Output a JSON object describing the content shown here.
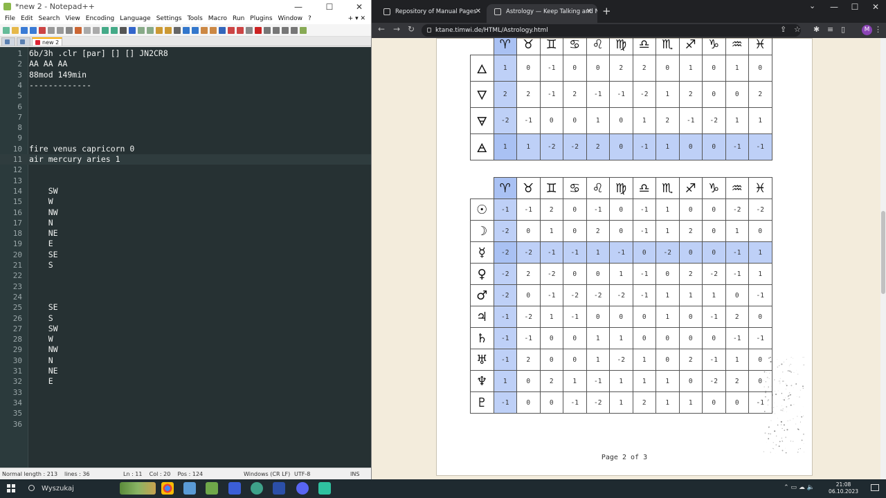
{
  "notepad": {
    "title": "*new 2 - Notepad++",
    "menu": [
      "File",
      "Edit",
      "Search",
      "View",
      "Encoding",
      "Language",
      "Settings",
      "Tools",
      "Macro",
      "Run",
      "Plugins",
      "Window",
      "?"
    ],
    "tabs": [
      {
        "label": ""
      },
      {
        "label": ""
      },
      {
        "label": "new 2"
      }
    ],
    "lines": [
      {
        "n": "1",
        "t": "6b/3h .clr [par] [] [] JN2CR8"
      },
      {
        "n": "2",
        "t": "AA AA AA"
      },
      {
        "n": "3",
        "t": "88mod 149min"
      },
      {
        "n": "4",
        "t": "-------------"
      },
      {
        "n": "5",
        "t": ""
      },
      {
        "n": "6",
        "t": ""
      },
      {
        "n": "7",
        "t": ""
      },
      {
        "n": "8",
        "t": ""
      },
      {
        "n": "9",
        "t": ""
      },
      {
        "n": "10",
        "t": "fire venus capricorn 0"
      },
      {
        "n": "11",
        "t": "air mercury aries 1"
      },
      {
        "n": "12",
        "t": ""
      },
      {
        "n": "13",
        "t": ""
      },
      {
        "n": "14",
        "t": "    SW"
      },
      {
        "n": "15",
        "t": "    W"
      },
      {
        "n": "16",
        "t": "    NW"
      },
      {
        "n": "17",
        "t": "    N"
      },
      {
        "n": "18",
        "t": "    NE"
      },
      {
        "n": "19",
        "t": "    E"
      },
      {
        "n": "20",
        "t": "    SE"
      },
      {
        "n": "21",
        "t": "    S"
      },
      {
        "n": "22",
        "t": ""
      },
      {
        "n": "23",
        "t": ""
      },
      {
        "n": "24",
        "t": ""
      },
      {
        "n": "25",
        "t": "    SE"
      },
      {
        "n": "26",
        "t": "    S"
      },
      {
        "n": "27",
        "t": "    SW"
      },
      {
        "n": "28",
        "t": "    W"
      },
      {
        "n": "29",
        "t": "    NW"
      },
      {
        "n": "30",
        "t": "    N"
      },
      {
        "n": "31",
        "t": "    NE"
      },
      {
        "n": "32",
        "t": "    E"
      },
      {
        "n": "33",
        "t": ""
      },
      {
        "n": "34",
        "t": ""
      },
      {
        "n": "35",
        "t": ""
      },
      {
        "n": "36",
        "t": ""
      }
    ],
    "current_line": 11,
    "status": {
      "length": "Normal length : 213",
      "lines": "lines : 36",
      "pos": "Ln : 11    Col : 20    Pos : 124",
      "eol": "Windows (CR LF)",
      "enc": "UTF-8",
      "mode": "INS"
    }
  },
  "browser": {
    "tabs": [
      {
        "label": "Repository of Manual Pages"
      },
      {
        "label": "Astrology — Keep Talking and N"
      }
    ],
    "url": "ktane.timwi.de/HTML/Astrology.html",
    "avatar": "M",
    "page_label": "Page 2 of 3"
  },
  "tables": {
    "zodiac": [
      "♈",
      "♉",
      "♊",
      "♋",
      "♌",
      "♍",
      "♎",
      "♏",
      "♐",
      "♑",
      "♒",
      "♓"
    ],
    "elements": {
      "highlight_col": 0,
      "highlight_row": 3,
      "rows": [
        {
          "symbol": "🜂",
          "values": [
            "1",
            "0",
            "-1",
            "0",
            "0",
            "2",
            "2",
            "0",
            "1",
            "0",
            "1",
            "0"
          ]
        },
        {
          "symbol": "🜄",
          "values": [
            "2",
            "2",
            "-1",
            "2",
            "-1",
            "-1",
            "-2",
            "1",
            "2",
            "0",
            "0",
            "2"
          ]
        },
        {
          "symbol": "🜃",
          "values": [
            "-2",
            "-1",
            "0",
            "0",
            "1",
            "0",
            "1",
            "2",
            "-1",
            "-2",
            "1",
            "1"
          ]
        },
        {
          "symbol": "🜁",
          "values": [
            "1",
            "1",
            "-2",
            "-2",
            "2",
            "0",
            "-1",
            "1",
            "0",
            "0",
            "-1",
            "-1"
          ]
        }
      ]
    },
    "planets": {
      "highlight_col": 0,
      "highlight_row": 2,
      "rows": [
        {
          "symbol": "☉",
          "values": [
            "-1",
            "-1",
            "2",
            "0",
            "-1",
            "0",
            "-1",
            "1",
            "0",
            "0",
            "-2",
            "-2"
          ]
        },
        {
          "symbol": "☽",
          "values": [
            "-2",
            "0",
            "1",
            "0",
            "2",
            "0",
            "-1",
            "1",
            "2",
            "0",
            "1",
            "0"
          ]
        },
        {
          "symbol": "☿",
          "values": [
            "-2",
            "-2",
            "-1",
            "-1",
            "1",
            "-1",
            "0",
            "-2",
            "0",
            "0",
            "-1",
            "1"
          ]
        },
        {
          "symbol": "♀",
          "values": [
            "-2",
            "2",
            "-2",
            "0",
            "0",
            "1",
            "-1",
            "0",
            "2",
            "-2",
            "-1",
            "1"
          ]
        },
        {
          "symbol": "♂",
          "values": [
            "-2",
            "0",
            "-1",
            "-2",
            "-2",
            "-2",
            "-1",
            "1",
            "1",
            "1",
            "0",
            "-1"
          ]
        },
        {
          "symbol": "♃",
          "values": [
            "-1",
            "-2",
            "1",
            "-1",
            "0",
            "0",
            "0",
            "1",
            "0",
            "-1",
            "2",
            "0"
          ]
        },
        {
          "symbol": "♄",
          "values": [
            "-1",
            "-1",
            "0",
            "0",
            "1",
            "1",
            "0",
            "0",
            "0",
            "0",
            "-1",
            "-1"
          ]
        },
        {
          "symbol": "♅",
          "values": [
            "-1",
            "2",
            "0",
            "0",
            "1",
            "-2",
            "1",
            "0",
            "2",
            "-1",
            "1",
            "0"
          ]
        },
        {
          "symbol": "♆",
          "values": [
            "1",
            "0",
            "2",
            "1",
            "-1",
            "1",
            "1",
            "1",
            "0",
            "-2",
            "2",
            "0"
          ]
        },
        {
          "symbol": "♇",
          "values": [
            "-1",
            "0",
            "0",
            "-1",
            "-2",
            "1",
            "2",
            "1",
            "1",
            "0",
            "0",
            "-1"
          ]
        }
      ]
    }
  },
  "taskbar": {
    "search": "Wyszukaj",
    "time": "21:08",
    "date": "06.10.2023",
    "colors": {
      "bg": "#1f2a30",
      "highlight": "#a9c1f3",
      "editor_bg": "#263133"
    }
  }
}
